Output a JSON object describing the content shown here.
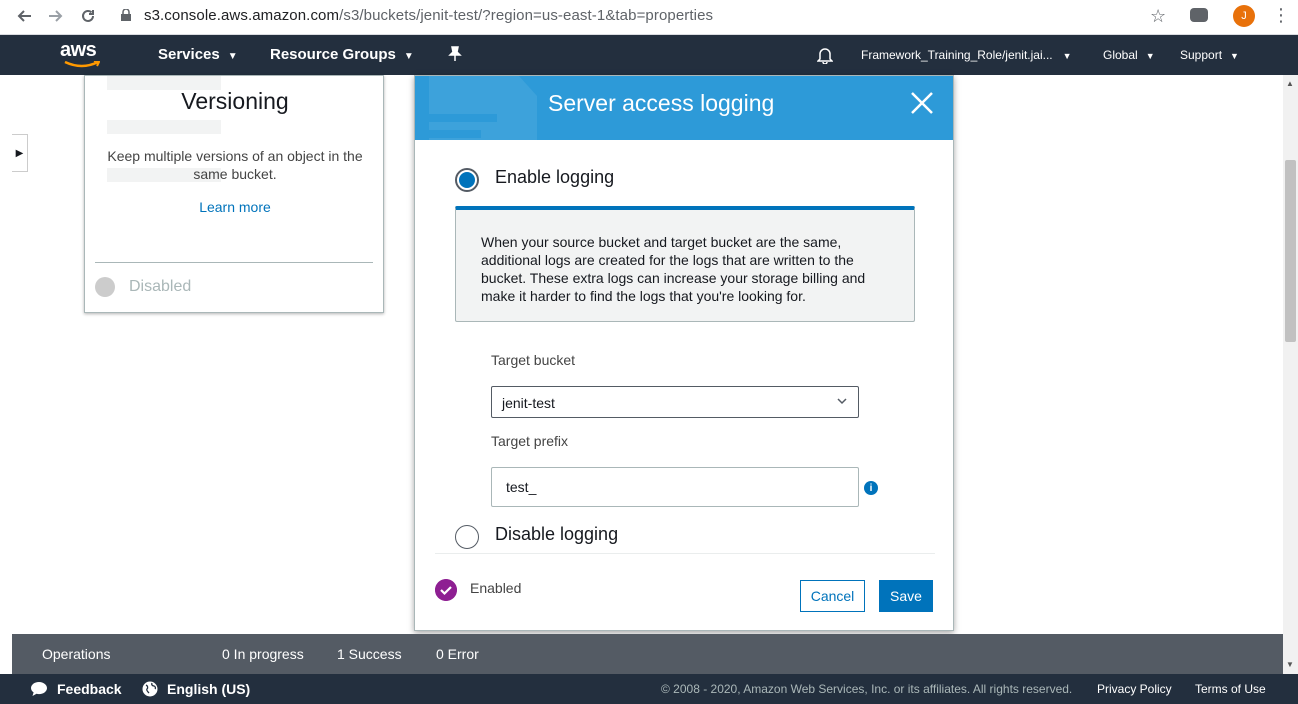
{
  "browser": {
    "url_host": "s3.console.aws.amazon.com",
    "url_path": "/s3/buckets/jenit-test/?region=us-east-1&tab=properties",
    "avatar_letter": "J"
  },
  "aws_nav": {
    "logo": "aws",
    "services": "Services",
    "resource_groups": "Resource Groups",
    "account": "Framework_Training_Role/jenit.jai...",
    "region": "Global",
    "support": "Support"
  },
  "versioning_card": {
    "title": "Versioning",
    "description": "Keep multiple versions of an object in the same bucket.",
    "learn_more": "Learn more",
    "status": "Disabled"
  },
  "modal": {
    "title": "Server access logging",
    "enable_label": "Enable logging",
    "info_text": "When your source bucket and target bucket are the same, additional logs are created for the logs that are written to the bucket. These extra logs can increase your storage billing and make it harder to find the logs that you're looking for.",
    "target_bucket_label": "Target bucket",
    "target_bucket_value": "jenit-test",
    "target_prefix_label": "Target prefix",
    "target_prefix_value": "test_",
    "disable_label": "Disable logging",
    "status_label": "Enabled",
    "cancel": "Cancel",
    "save": "Save"
  },
  "operations": {
    "label": "Operations",
    "in_progress": "0 In progress",
    "success": "1 Success",
    "error": "0 Error"
  },
  "footer": {
    "feedback": "Feedback",
    "language": "English (US)",
    "copyright": "© 2008 - 2020, Amazon Web Services, Inc. or its affiliates. All rights reserved.",
    "privacy": "Privacy Policy",
    "terms": "Terms of Use"
  },
  "colors": {
    "aws_nav": "#232f3e",
    "modal_header": "#2d9ad8",
    "primary": "#0073bb",
    "enabled_badge": "#8e1f92"
  }
}
